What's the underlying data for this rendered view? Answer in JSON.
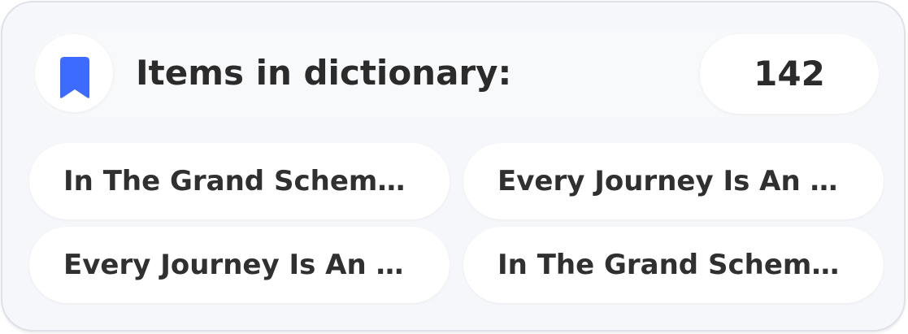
{
  "header": {
    "title": "Items in dictionary:",
    "count": "142",
    "icon": "bookmark-icon",
    "icon_color": "#3d6bff"
  },
  "items": [
    {
      "label": "In The Grand Scheme..."
    },
    {
      "label": "Every Journey Is An O..."
    },
    {
      "label": "Every Journey Is An O..."
    },
    {
      "label": "In The Grand Scheme..."
    }
  ],
  "colors": {
    "card_background": "#f6f7fa",
    "chip_background": "#ffffff",
    "text": "#2b2b2b",
    "accent": "#3d6bff"
  }
}
